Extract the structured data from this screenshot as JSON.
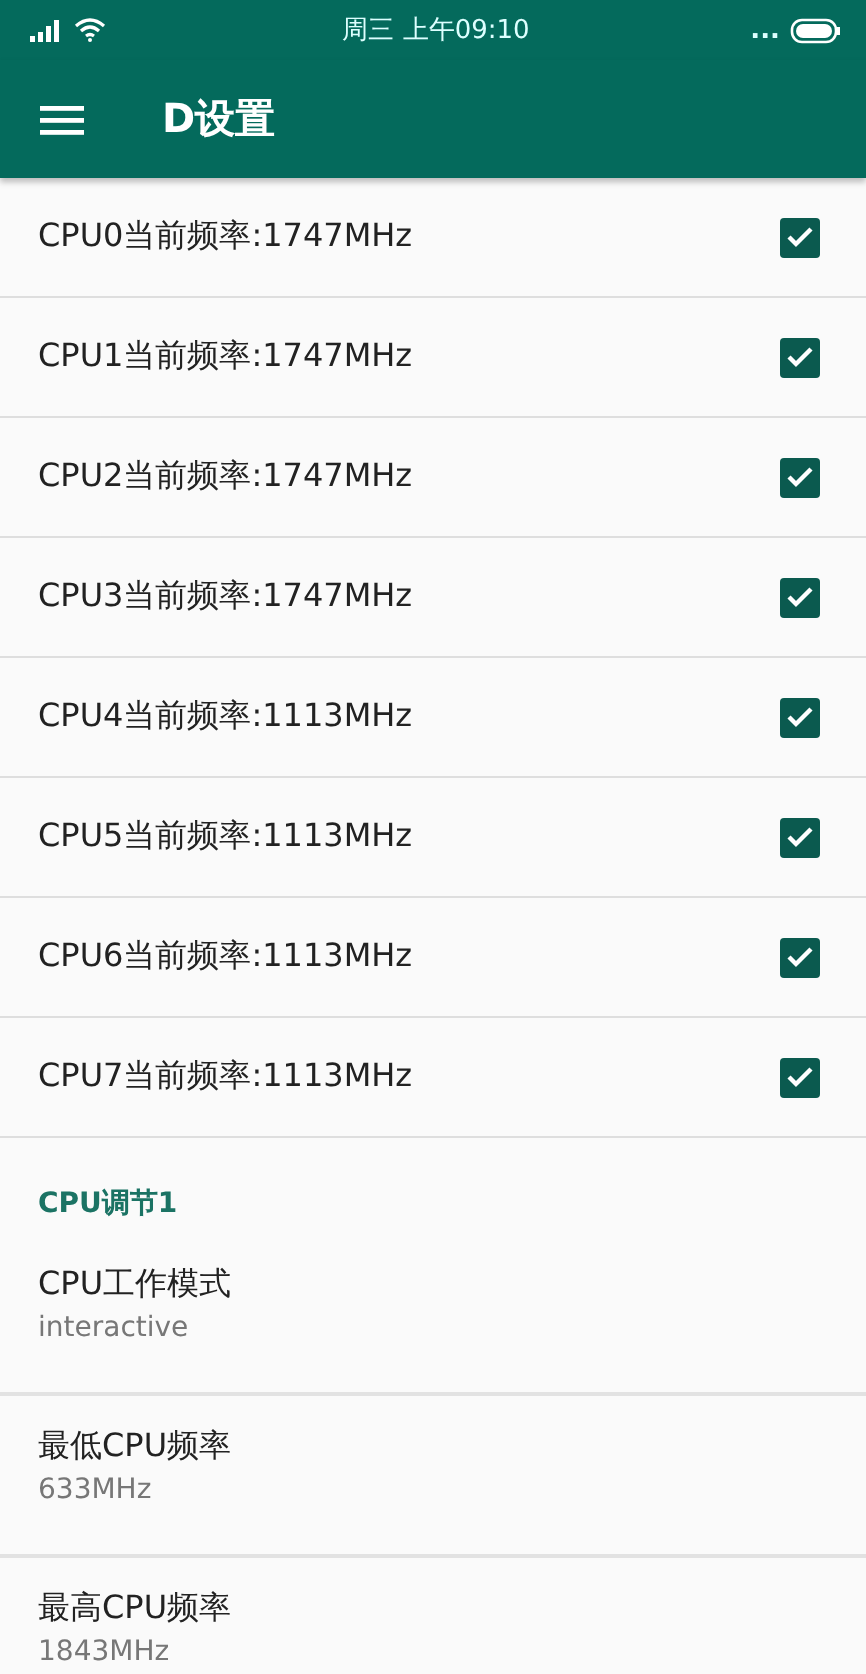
{
  "status_bar": {
    "time": "周三 上午09:10",
    "more": "..."
  },
  "app_bar": {
    "title": "D设置"
  },
  "cpu_rows": [
    {
      "label": "CPU0当前频率:1747MHz",
      "checked": true
    },
    {
      "label": "CPU1当前频率:1747MHz",
      "checked": true
    },
    {
      "label": "CPU2当前频率:1747MHz",
      "checked": true
    },
    {
      "label": "CPU3当前频率:1747MHz",
      "checked": true
    },
    {
      "label": "CPU4当前频率:1113MHz",
      "checked": true
    },
    {
      "label": "CPU5当前频率:1113MHz",
      "checked": true
    },
    {
      "label": "CPU6当前频率:1113MHz",
      "checked": true
    },
    {
      "label": "CPU7当前频率:1113MHz",
      "checked": true
    }
  ],
  "section": {
    "title": "CPU调节1",
    "items": [
      {
        "title": "CPU工作模式",
        "summary": "interactive"
      },
      {
        "title": "最低CPU频率",
        "summary": "633MHz"
      },
      {
        "title": "最高CPU频率",
        "summary": "1843MHz"
      }
    ]
  }
}
